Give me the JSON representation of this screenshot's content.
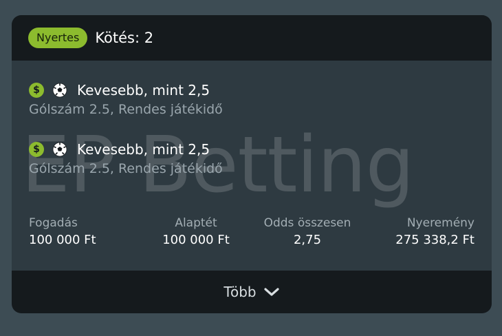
{
  "header": {
    "badge": "Nyertes",
    "title": "Kötés: 2"
  },
  "watermark": "EP Betting",
  "selections": [
    {
      "currency_icon": "dollar-icon",
      "sport_icon": "soccer-ball-icon",
      "currency_symbol": "$",
      "market": "Kevesebb, mint 2,5",
      "description": "Gólszám 2.5, Rendes játékidő"
    },
    {
      "currency_icon": "dollar-icon",
      "sport_icon": "soccer-ball-icon",
      "currency_symbol": "$",
      "market": "Kevesebb, mint 2,5",
      "description": "Gólszám 2.5, Rendes játékidő"
    }
  ],
  "stats": [
    {
      "label": "Fogadás",
      "value": "100 000 Ft"
    },
    {
      "label": "Alaptét",
      "value": "100 000 Ft"
    },
    {
      "label": "Odds összesen",
      "value": "2,75"
    },
    {
      "label": "Nyeremény",
      "value": "275 338,2 Ft"
    }
  ],
  "footer": {
    "more_label": "Több",
    "icon": "chevron-down-icon"
  },
  "colors": {
    "page_background": "#3d4c54",
    "card_body": "#2e3a41",
    "card_header_footer": "#151a1d",
    "accent_green": "#8cbb2e"
  }
}
